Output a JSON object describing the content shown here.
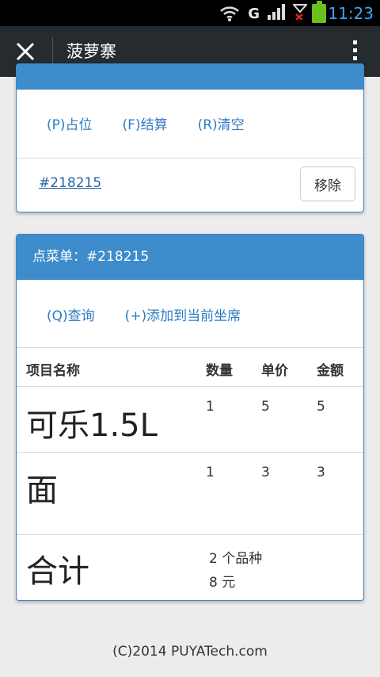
{
  "statusbar": {
    "network": "G",
    "signal2": "2",
    "time": "11:23",
    "battery_color": "#6bc21f",
    "time_color": "#39a4ff"
  },
  "appbar": {
    "title": "菠萝寨",
    "close_icon": "close-icon",
    "menu_icon": "more-vertical-icon"
  },
  "seat_card": {
    "actions": [
      "(P)占位",
      "(F)结算",
      "(R)清空"
    ],
    "order_link": "#218215",
    "remove_label": "移除"
  },
  "menu_card": {
    "title": "点菜单：#218215",
    "actions": [
      "(Q)查询",
      "(+)添加到当前坐席"
    ],
    "columns": [
      "项目名称",
      "数量",
      "单价",
      "金额"
    ],
    "rows": [
      {
        "name": "可乐1.5L",
        "qty": "1",
        "price": "5",
        "amount": "5"
      },
      {
        "name": "面",
        "qty": "1",
        "price": "3",
        "amount": "3"
      }
    ],
    "total_label": "合计",
    "total_items": "2 个品种",
    "total_amount": "8 元"
  },
  "footer": "(C)2014 PUYATech.com",
  "colors": {
    "header_blue": "#3e8ccb",
    "link_blue": "#2f7bc4",
    "appbar": "#262b30"
  }
}
